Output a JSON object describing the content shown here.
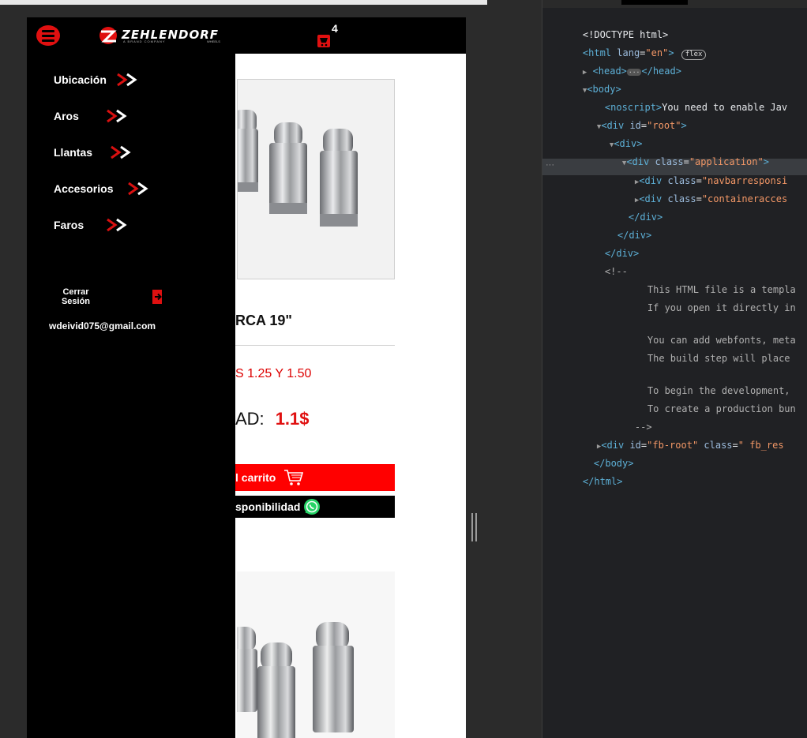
{
  "navbar": {
    "logo_text": "ZEHLENDORF",
    "logo_sub_left": "A BRAND COMPANY",
    "logo_sub_right": "WHEELS",
    "cart_count": "4",
    "colors": {
      "accent": "#e01010",
      "bar": "#000000"
    }
  },
  "side_menu": {
    "items": [
      {
        "label": "Ubicación"
      },
      {
        "label": "Aros"
      },
      {
        "label": "Llantas"
      },
      {
        "label": "Accesorios"
      },
      {
        "label": "Faros"
      }
    ],
    "logout_line1": "Cerrar",
    "logout_line2": "Sesión",
    "user_email": "wdeivid075@gmail.com"
  },
  "product": {
    "title": "RCA 19\"",
    "sizes": "S 1.25 Y 1.50",
    "price_label": "AD:",
    "price_value": "1.1$",
    "add_to_cart": "l carrito",
    "availability": "sponibilidad"
  },
  "devtools": {
    "lines": {
      "doctype": "<!DOCTYPE html>",
      "html_open_tag": "<html ",
      "html_lang_attr": "lang",
      "html_lang_val": "\"en\"",
      "html_close_bracket": ">",
      "flex_badge": "flex",
      "head_open": "<head>",
      "head_dots": "···",
      "head_close": "</head>",
      "body_open": "<body>",
      "noscript_open": "<noscript>",
      "noscript_text": "You need to enable Jav",
      "root_open_tag": "<div ",
      "root_attr": "id",
      "root_val": "\"root\"",
      "root_close": ">",
      "div_open": "<div>",
      "app_open_tag": "<div ",
      "app_attr": "class",
      "app_val": "\"application\"",
      "app_close": ">",
      "navbar_tag": "<div ",
      "navbar_attr": "class",
      "navbar_val": "\"navbarresponsi",
      "container_tag": "<div ",
      "container_attr": "class",
      "container_val": "\"containeracces",
      "div_close_1": "</div>",
      "div_close_2": "</div>",
      "div_close_3": "</div>",
      "comment_open": "<!--",
      "comment_1": "This HTML file is a templa",
      "comment_2": "If you open it directly in",
      "comment_3": "You can add webfonts, meta",
      "comment_4": "The build step will place",
      "comment_5": "To begin the development,",
      "comment_6": "To create a production bun",
      "comment_close": "-->",
      "fb_tag": "<div ",
      "fb_id_attr": "id",
      "fb_id_val": "\"fb-root\"",
      "fb_class_attr": " class",
      "fb_class_val": "\" fb_res",
      "body_close": "</body>",
      "html_close": "</html>"
    }
  }
}
